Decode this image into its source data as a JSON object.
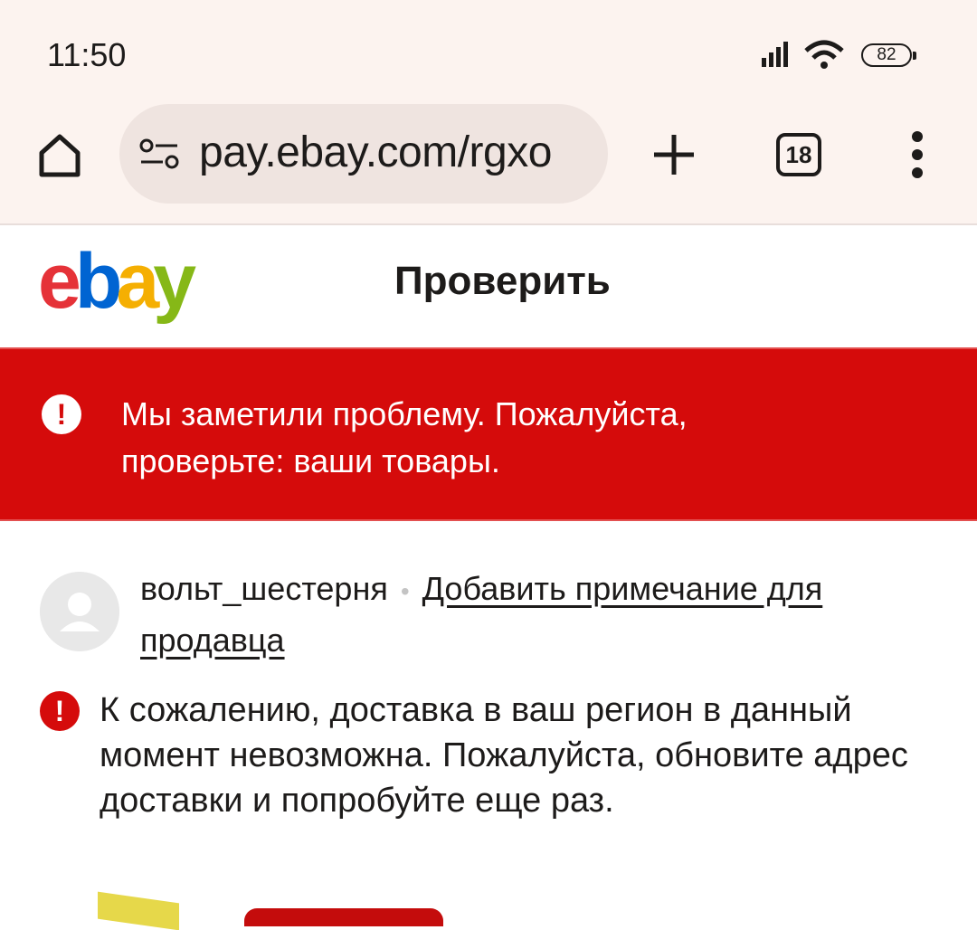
{
  "status_bar": {
    "time": "11:50",
    "battery": "82",
    "icons": [
      "signal-icon",
      "wifi-icon",
      "battery-icon"
    ]
  },
  "browser": {
    "url": "pay.ebay.com/rgxo",
    "tab_count": "18",
    "icons": [
      "home-icon",
      "site-settings-icon",
      "plus-icon",
      "tabs-icon",
      "more-vert-icon"
    ]
  },
  "header": {
    "logo_letters": [
      "e",
      "b",
      "a",
      "y"
    ],
    "logo_colors": [
      "#e53238",
      "#0064d2",
      "#f5af02",
      "#86b817"
    ],
    "title": "Проверить"
  },
  "error_banner": {
    "icon": "!",
    "message_line1": "Мы заметили проблему. Пожалуйста,",
    "message_line2": "проверьте: ваши товары.",
    "background": "#d50b0b"
  },
  "seller": {
    "name": "вольт_шестерня",
    "separator": "•",
    "note_link": "Добавить примечание для продавца"
  },
  "shipping_error": {
    "icon": "!",
    "message": "К сожалению, доставка в ваш регион в данный момент невозможна. Пожалуйста, обновите адрес доставки и попробуйте еще раз."
  }
}
